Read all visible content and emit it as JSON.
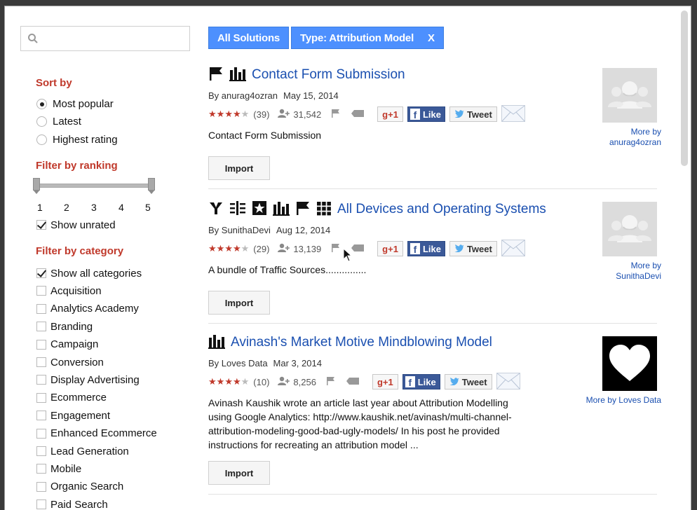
{
  "search": {
    "placeholder": "",
    "icon": "search-icon"
  },
  "filters": {
    "sort_by": {
      "title": "Sort by",
      "options": [
        {
          "label": "Most popular",
          "selected": true
        },
        {
          "label": "Latest",
          "selected": false
        },
        {
          "label": "Highest rating",
          "selected": false
        }
      ]
    },
    "ranking": {
      "title": "Filter by ranking",
      "ticks": [
        "1",
        "2",
        "3",
        "4",
        "5"
      ],
      "show_unrated": {
        "label": "Show unrated",
        "checked": true
      }
    },
    "category": {
      "title": "Filter by category",
      "items": [
        {
          "label": "Show all categories",
          "checked": true
        },
        {
          "label": "Acquisition",
          "checked": false
        },
        {
          "label": "Analytics Academy",
          "checked": false
        },
        {
          "label": "Branding",
          "checked": false
        },
        {
          "label": "Campaign",
          "checked": false
        },
        {
          "label": "Conversion",
          "checked": false
        },
        {
          "label": "Display Advertising",
          "checked": false
        },
        {
          "label": "Ecommerce",
          "checked": false
        },
        {
          "label": "Engagement",
          "checked": false
        },
        {
          "label": "Enhanced Ecommerce",
          "checked": false
        },
        {
          "label": "Lead Generation",
          "checked": false
        },
        {
          "label": "Mobile",
          "checked": false
        },
        {
          "label": "Organic Search",
          "checked": false
        },
        {
          "label": "Paid Search",
          "checked": false
        }
      ]
    }
  },
  "chips": [
    {
      "label": "All Solutions"
    },
    {
      "label": "Type: Attribution Model",
      "close": "X"
    }
  ],
  "results": [
    {
      "icons": [
        "flag-icon",
        "bar-chart-icon"
      ],
      "title": "Contact Form Submission",
      "author": "By anurag4ozran",
      "date": "May 15, 2014",
      "rating": 4,
      "rating_count": "(39)",
      "imports": "31,542",
      "description": "Contact Form Submission",
      "import_label": "Import",
      "more_by": "More by\nanurag4ozran",
      "thumb": "people-icon"
    },
    {
      "icons": [
        "segment-icon",
        "filter-icon",
        "star-badge-icon",
        "bar-chart-icon",
        "flag-icon",
        "grid-icon"
      ],
      "title": "All Devices and Operating Systems",
      "author": "By SunithaDevi",
      "date": "Aug 12, 2014",
      "rating": 4,
      "rating_count": "(29)",
      "imports": "13,139",
      "description": "A bundle of Traffic Sources...............",
      "import_label": "Import",
      "more_by": "More by\nSunithaDevi",
      "thumb": "people-icon"
    },
    {
      "icons": [
        "bar-chart-icon"
      ],
      "title": "Avinash's Market Motive Mindblowing Model",
      "author": "By Loves Data",
      "date": "Mar 3, 2014",
      "rating": 4,
      "rating_count": "(10)",
      "imports": "8,256",
      "description": "Avinash Kaushik wrote an article last year about Attribution Modelling\nusing Google Analytics: http://www.kaushik.net/avinash/multi-channel-\nattribution-modeling-good-bad-ugly-models/ In his post he provided\ninstructions for recreating an attribution model ...",
      "import_label": "Import",
      "more_by": "More by Loves Data",
      "thumb": "heart-icon"
    }
  ],
  "social": {
    "gplus": "g+1",
    "like": "Like",
    "fb": "f",
    "tweet": "Tweet"
  },
  "colors": {
    "accent": "#4d90fe",
    "link": "#1a4fb0",
    "filter_title": "#c0392b",
    "facebook": "#3b5998"
  }
}
